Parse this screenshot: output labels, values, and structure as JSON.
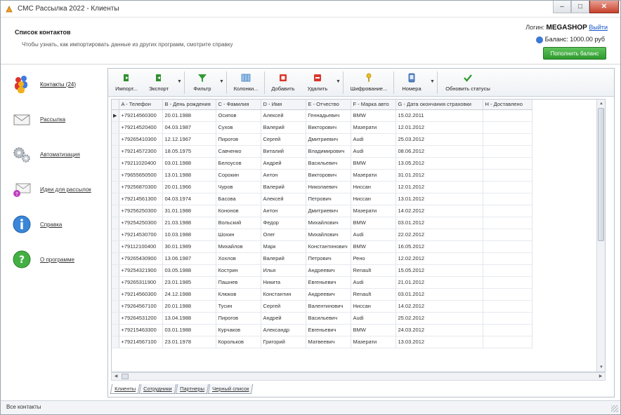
{
  "window": {
    "title": "СМС Рассылка 2022 - Клиенты"
  },
  "header": {
    "title": "Список контактов",
    "subtitle": "Чтобы узнать, как импортировать данные из других программ, смотрите справку",
    "login_label": "Логин:",
    "login_value": "MEGASHOP",
    "logout_link": "Выйти",
    "balance_text": "Баланс: 1000.00 руб",
    "topup_label": "Пополнить баланс"
  },
  "sidebar": {
    "items": [
      {
        "label": "Контакты (24)",
        "icon": "contacts-icon"
      },
      {
        "label": "Рассылка",
        "icon": "mail-icon"
      },
      {
        "label": "Автоматизация",
        "icon": "gears-icon"
      },
      {
        "label": "Идеи для рассылок",
        "icon": "ideas-icon"
      },
      {
        "label": "Справка",
        "icon": "info-icon"
      },
      {
        "label": "О программе",
        "icon": "help-icon"
      }
    ]
  },
  "toolbar": {
    "import": "Импорт...",
    "export": "Экспорт",
    "filter": "Фильтр",
    "columns": "Колонки...",
    "add": "Добавить",
    "delete": "Удалить",
    "encrypt": "Шифрование...",
    "numbers": "Номера",
    "refresh": "Обновить статусы"
  },
  "grid": {
    "columns": [
      "A - Телефон",
      "B - День рождения",
      "C - Фамилия",
      "D - Имя",
      "E - Отчество",
      "F - Марка авто",
      "G - Дата окончания страховки",
      "H - Доставлено"
    ],
    "rows": [
      [
        "+79214560300",
        "20.01.1988",
        "Осипов",
        "Алексей",
        "Геннадьевич",
        "BMW",
        "15.02.2011",
        ""
      ],
      [
        "+79214520400",
        "04.03.1987",
        "Сухов",
        "Валерий",
        "Викторович",
        "Мазерати",
        "12.01.2012",
        ""
      ],
      [
        "+79265410300",
        "12.12.1967",
        "Пирогов",
        "Сергей",
        "Дмитриевич",
        "Audi",
        "25.03.2012",
        ""
      ],
      [
        "+79214572300",
        "18.05.1975",
        "Савченко",
        "Виталий",
        "Владимирович",
        "Audi",
        "08.06.2012",
        ""
      ],
      [
        "+79211020400",
        "03.01.1988",
        "Белоусов",
        "Андрей",
        "Васильевич",
        "BMW",
        "13.05.2012",
        ""
      ],
      [
        "+79655650500",
        "13.01.1988",
        "Сорокин",
        "Антон",
        "Викторович",
        "Мазерати",
        "31.01.2012",
        ""
      ],
      [
        "+79256870300",
        "20.01.1966",
        "Чуров",
        "Валерий",
        "Николаевич",
        "Ниссан",
        "12.01.2012",
        ""
      ],
      [
        "+79214561300",
        "04.03.1974",
        "Басова",
        "Алексей",
        "Петрович",
        "Ниссан",
        "13.01.2012",
        ""
      ],
      [
        "+79256250300",
        "31.01.1988",
        "Кононов",
        "Антон",
        "Дмитриевич",
        "Мазерати",
        "14.02.2012",
        ""
      ],
      [
        "+79254250300",
        "21.03.1988",
        "Вольский",
        "Федор",
        "Михайлович",
        "BMW",
        "03.01.2012",
        ""
      ],
      [
        "+79214530700",
        "10.03.1988",
        "Шохин",
        "Олег",
        "Михайлович",
        "Audi",
        "22.02.2012",
        ""
      ],
      [
        "+79112100400",
        "30.01.1989",
        "Михайлов",
        "Марк",
        "Константинович",
        "BMW",
        "16.05.2012",
        ""
      ],
      [
        "+79265430900",
        "13.06.1987",
        "Хохлов",
        "Валерий",
        "Петрович",
        "Рено",
        "12.02.2012",
        ""
      ],
      [
        "+79254321900",
        "03.05.1988",
        "Кострин",
        "Илья",
        "Андреевич",
        "Renault",
        "15.05.2012",
        ""
      ],
      [
        "+79265311900",
        "23.01.1985",
        "Пашнев",
        "Никита",
        "Евгеньевич",
        "Audi",
        "21.01.2012",
        ""
      ],
      [
        "+79214560300",
        "24.12.1988",
        "Клюков",
        "Константин",
        "Андреевич",
        "Renault",
        "03.01.2012",
        ""
      ],
      [
        "+79264567100",
        "20.01.1988",
        "Тусин",
        "Сергей",
        "Валентинович",
        "Ниссан",
        "14.02.2012",
        ""
      ],
      [
        "+79264531200",
        "13.04.1988",
        "Пирогов",
        "Андрей",
        "Васильевич",
        "Audi",
        "25.02.2012",
        ""
      ],
      [
        "+79215463300",
        "03.01.1988",
        "Курчаков",
        "Александр",
        "Евгеньевич",
        "BMW",
        "24.03.2012",
        ""
      ],
      [
        "+79214567100",
        "23.01.1978",
        "Корольков",
        "Григорий",
        "Матвеевич",
        "Мазерати",
        "13.03.2012",
        ""
      ]
    ],
    "current_row_marker": "▶"
  },
  "tabs": [
    "Клиенты",
    "Сотрудники",
    "Партнеры",
    "Черный список"
  ],
  "status": {
    "text": "Все контакты"
  },
  "colors": {
    "accent": "#2e9a2e",
    "link": "#1a56c8"
  }
}
